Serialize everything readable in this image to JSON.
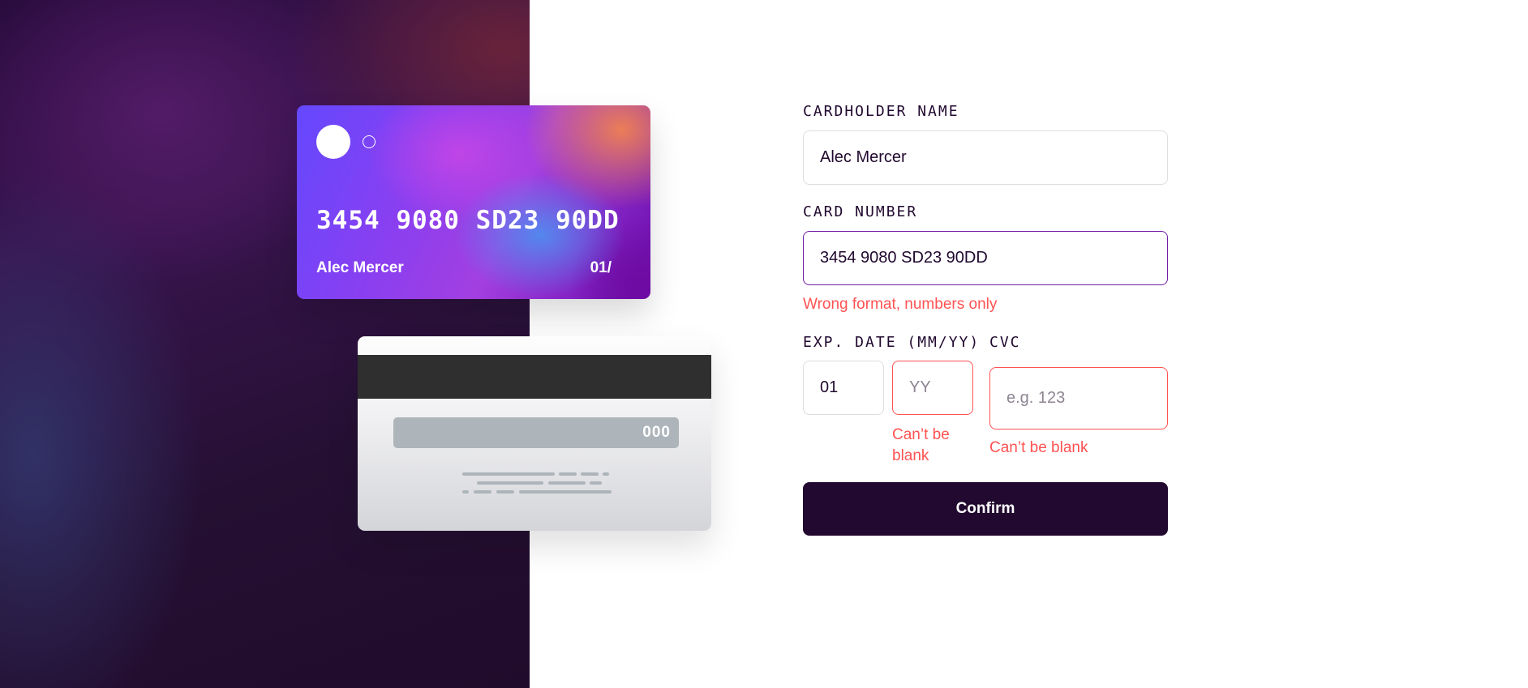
{
  "card_preview": {
    "front": {
      "number": "3454 9080 SD23 90DD",
      "holder_name": "Alec Mercer",
      "expiry": "01/"
    },
    "back": {
      "cvc": "000"
    }
  },
  "form": {
    "cardholder_name": {
      "label": "CARDHOLDER NAME",
      "value": "Alec Mercer"
    },
    "card_number": {
      "label": "CARD NUMBER",
      "value": "3454 9080 SD23 90DD",
      "error": "Wrong format, numbers only"
    },
    "expiry": {
      "label": "EXP. DATE (MM/YY)",
      "month_value": "01",
      "year_placeholder": "YY",
      "year_error_line1": "Can’t be",
      "year_error_line2": "blank"
    },
    "cvc": {
      "label": "CVC",
      "placeholder": "e.g. 123",
      "error": "Can’t be blank"
    },
    "confirm_label": "Confirm"
  },
  "colors": {
    "dark_violet": "#21092f",
    "error_red": "#ff5252",
    "focus_purple": "#6f1ea6",
    "border_gray": "#dedddf"
  }
}
